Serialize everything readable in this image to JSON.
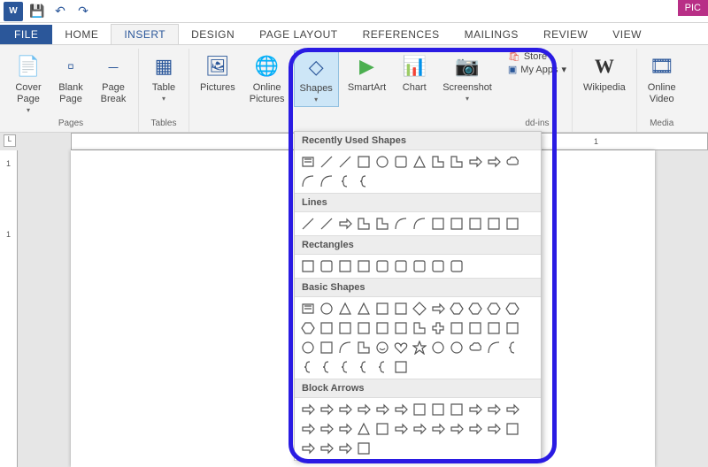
{
  "qat": {
    "save": "Save",
    "undo": "Undo",
    "redo": "Redo"
  },
  "pic_tab": "PIC",
  "tabs": {
    "file": "FILE",
    "home": "HOME",
    "insert": "INSERT",
    "design": "DESIGN",
    "page_layout": "PAGE LAYOUT",
    "references": "REFERENCES",
    "mailings": "MAILINGS",
    "review": "REVIEW",
    "view": "VIEW"
  },
  "ribbon": {
    "pages": {
      "label": "Pages",
      "cover_page": "Cover\nPage",
      "blank_page": "Blank\nPage",
      "page_break": "Page\nBreak"
    },
    "tables": {
      "label": "Tables",
      "table": "Table"
    },
    "illustrations": {
      "pictures": "Pictures",
      "online_pictures": "Online\nPictures",
      "shapes": "Shapes",
      "smartart": "SmartArt",
      "chart": "Chart",
      "screenshot": "Screenshot"
    },
    "addins": {
      "label": "dd-ins",
      "store": "Store",
      "my_apps": "My Apps",
      "wikipedia": "Wikipedia"
    },
    "media": {
      "label": "Media",
      "online_video": "Online\nVideo"
    }
  },
  "ruler": {
    "marks": [
      "1"
    ],
    "left_tab": "L"
  },
  "vruler": {
    "marks": [
      "1",
      "1"
    ]
  },
  "shapes_dropdown": {
    "recently_used": "Recently Used Shapes",
    "lines": "Lines",
    "rectangles": "Rectangles",
    "basic_shapes": "Basic Shapes",
    "block_arrows": "Block Arrows",
    "recent_count": 16,
    "lines_count": 12,
    "rectangles_count": 9,
    "basic_count": 42,
    "arrows_count": 28
  },
  "colors": {
    "word_blue": "#2b579a",
    "highlight": "#2a1be3"
  }
}
